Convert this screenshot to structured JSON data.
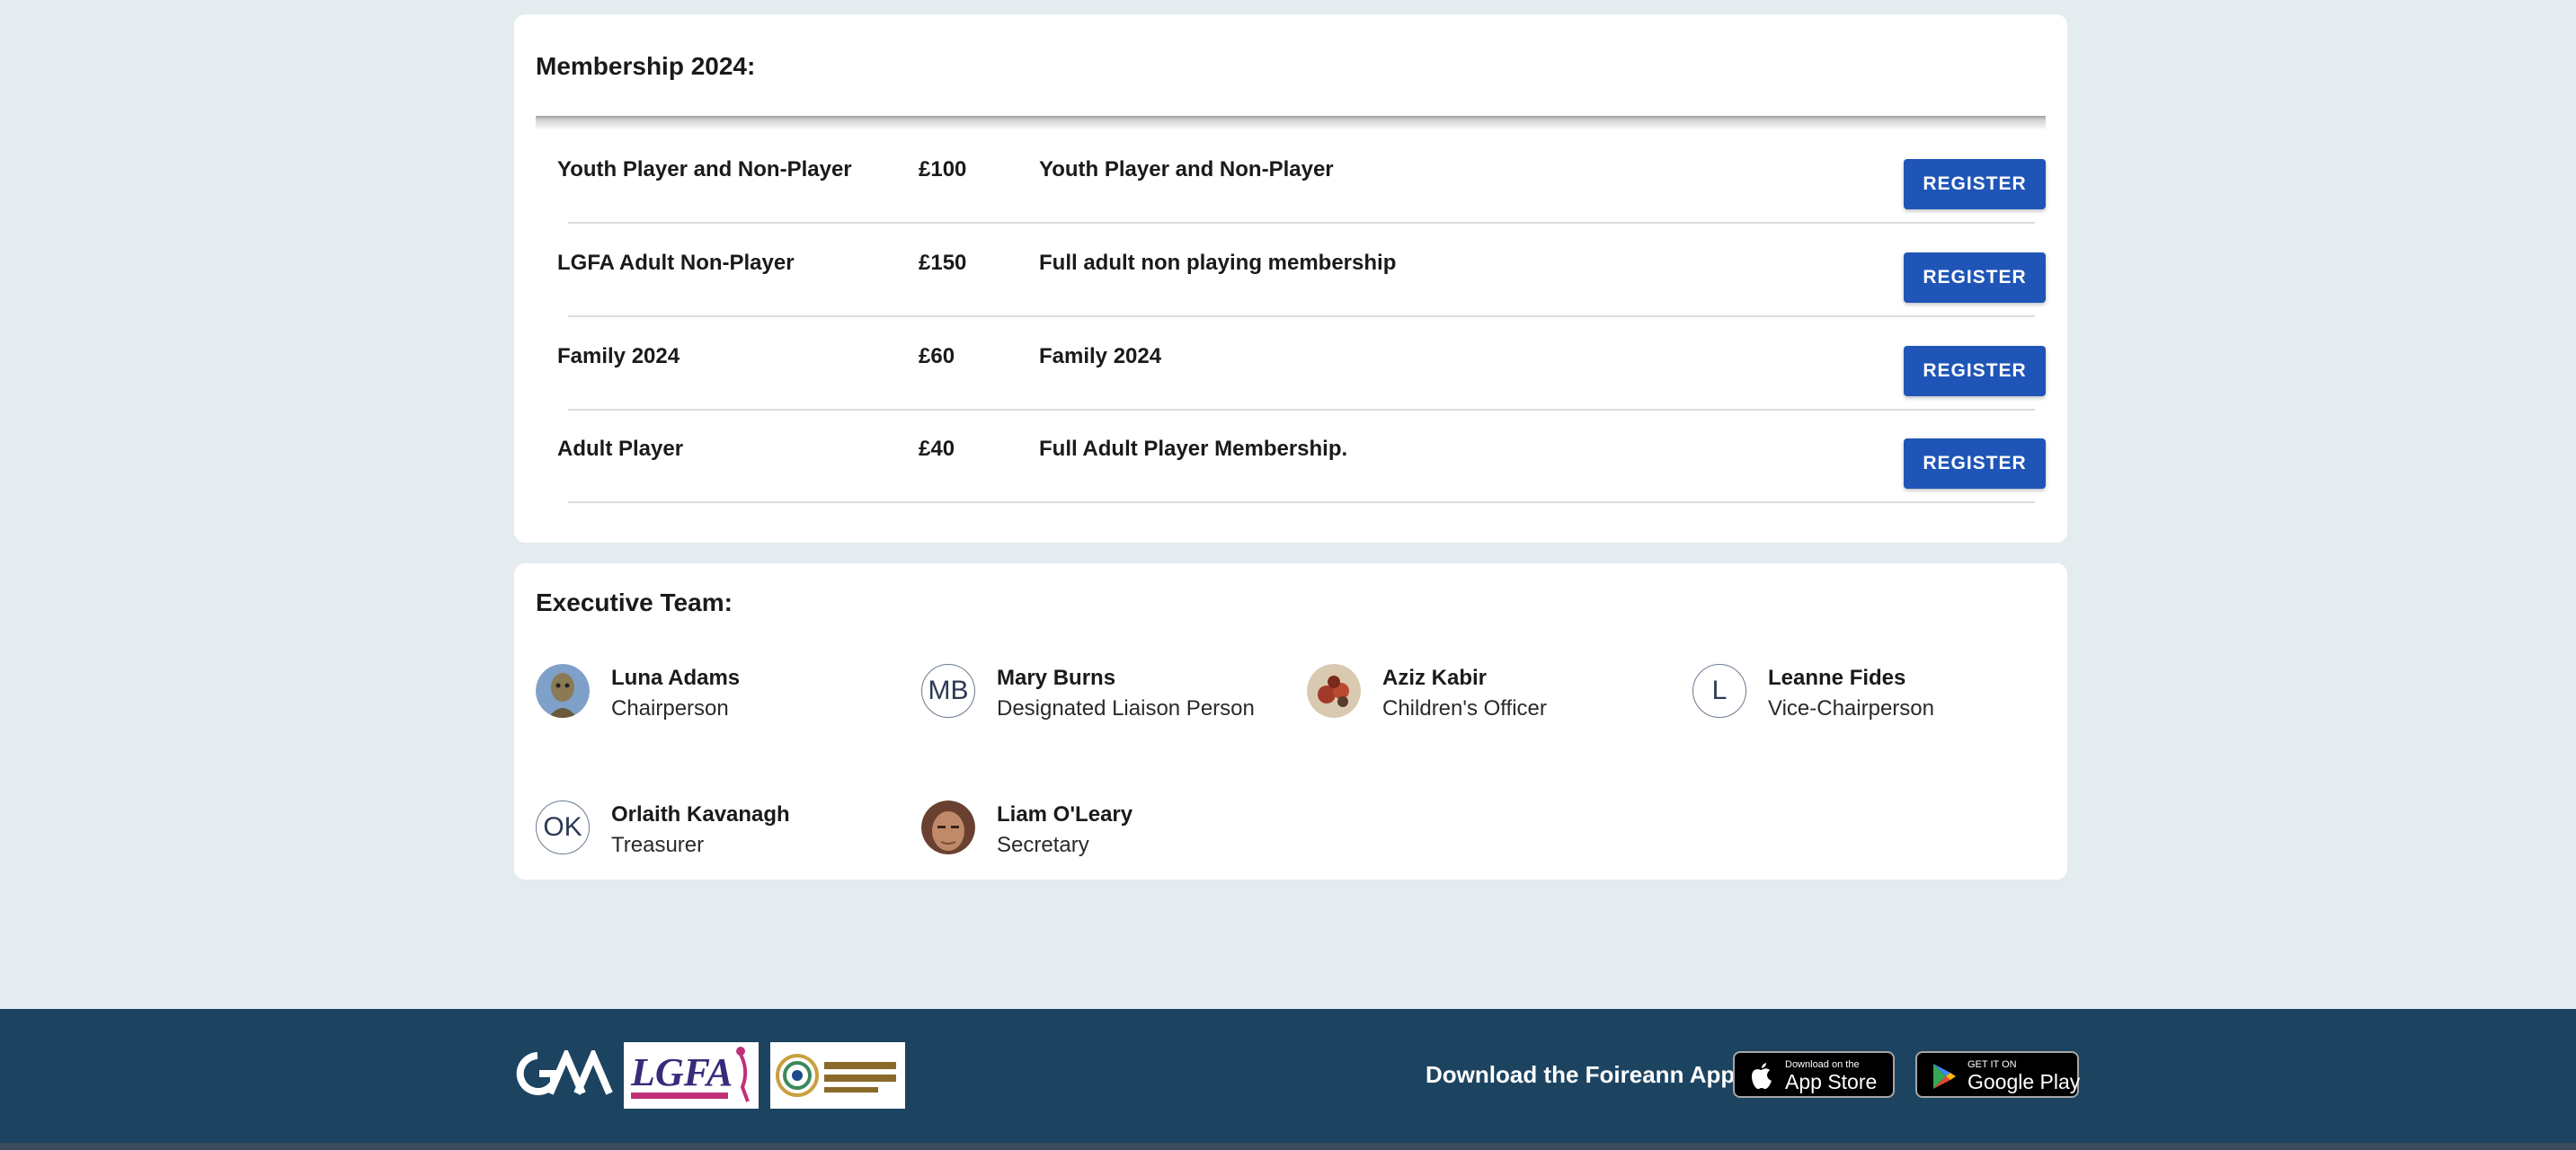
{
  "membership": {
    "title": "Membership 2024:",
    "rows": [
      {
        "name": "Youth Player and Non-Player",
        "price": "£100",
        "description": "Youth Player and Non-Player",
        "action": "REGISTER"
      },
      {
        "name": "LGFA Adult Non-Player",
        "price": "£150",
        "description": "Full adult non playing membership",
        "action": "REGISTER"
      },
      {
        "name": "Family 2024",
        "price": "£60",
        "description": "Family 2024",
        "action": "REGISTER"
      },
      {
        "name": "Adult Player",
        "price": "£40",
        "description": "Full Adult Player Membership.",
        "action": "REGISTER"
      }
    ]
  },
  "executive": {
    "title": "Executive Team:",
    "members": [
      {
        "name": "Luna Adams",
        "role": "Chairperson",
        "avatar": "photo"
      },
      {
        "name": "Mary Burns",
        "role": "Designated Liaison Person",
        "initials": "MB"
      },
      {
        "name": "Aziz Kabir",
        "role": "Children's Officer",
        "avatar": "photo"
      },
      {
        "name": "Leanne Fides",
        "role": "Vice-Chairperson",
        "initials": "L"
      },
      {
        "name": "Orlaith Kavanagh",
        "role": "Treasurer",
        "initials": "OK"
      },
      {
        "name": "Liam O'Leary",
        "role": "Secretary",
        "avatar": "photo"
      }
    ]
  },
  "footer": {
    "download_label": "Download the Foireann App:",
    "app_store": {
      "small": "Download on the",
      "big": "App Store"
    },
    "google_play": {
      "small": "GET IT ON",
      "big": "Google Play"
    },
    "logos": [
      "gaa-logo",
      "lgfa-logo",
      "camogie-association-logo"
    ]
  },
  "colors": {
    "page_bg": "#e4ecf0",
    "footer_bg": "#1c4461",
    "register_button": "#1f55b7"
  }
}
